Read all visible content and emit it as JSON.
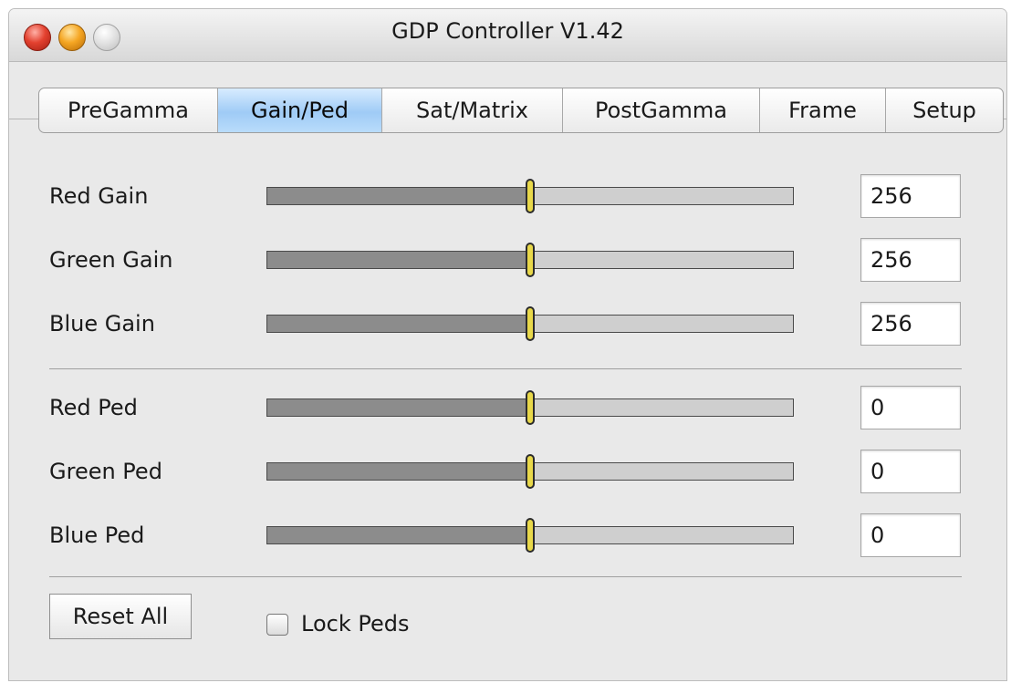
{
  "window": {
    "title": "GDP Controller V1.42"
  },
  "tabs": [
    {
      "label": "PreGamma",
      "active": false
    },
    {
      "label": "Gain/Ped",
      "active": true
    },
    {
      "label": "Sat/Matrix",
      "active": false
    },
    {
      "label": "PostGamma",
      "active": false
    },
    {
      "label": "Frame",
      "active": false
    },
    {
      "label": "Setup",
      "active": false
    }
  ],
  "gain_rows": [
    {
      "label": "Red Gain",
      "value": "256",
      "slider_fraction": 0.5
    },
    {
      "label": "Green Gain",
      "value": "256",
      "slider_fraction": 0.5
    },
    {
      "label": "Blue Gain",
      "value": "256",
      "slider_fraction": 0.5
    }
  ],
  "ped_rows": [
    {
      "label": "Red Ped",
      "value": "0",
      "slider_fraction": 0.5
    },
    {
      "label": "Green Ped",
      "value": "0",
      "slider_fraction": 0.5
    },
    {
      "label": "Blue Ped",
      "value": "0",
      "slider_fraction": 0.5
    }
  ],
  "footer": {
    "reset_label": "Reset All",
    "lock_label": "Lock Peds",
    "lock_checked": false
  },
  "colors": {
    "active_tab": "#9fcbf6",
    "slider_thumb": "#e8d84a",
    "slider_fill": "#8c8c8c",
    "slider_track": "#cfcfcf"
  },
  "icons": {
    "close": "close-icon",
    "minimize": "minimize-icon",
    "zoom": "zoom-icon"
  }
}
